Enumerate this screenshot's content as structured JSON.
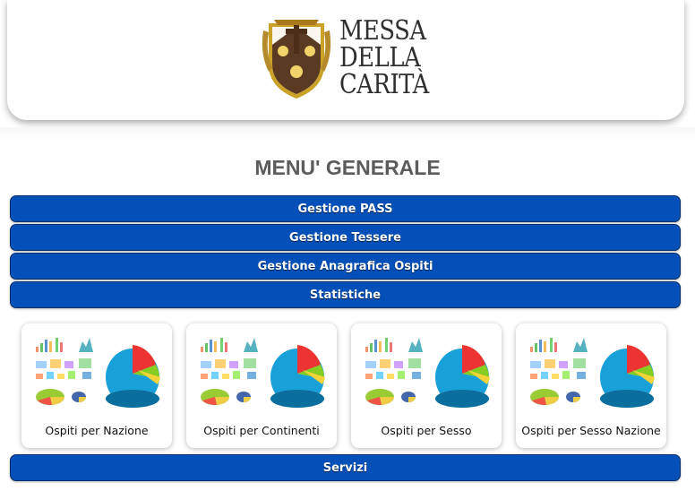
{
  "header": {
    "logo_line1": "MESSA",
    "logo_line2": "DELLA",
    "logo_line3": "CARITÀ"
  },
  "page_title": "MENU' GENERALE",
  "menu": {
    "items": [
      {
        "label": "Gestione PASS"
      },
      {
        "label": "Gestione Tessere"
      },
      {
        "label": "Gestione Anagrafica Ospiti"
      },
      {
        "label": "Statistiche"
      }
    ],
    "services_label": "Servizi"
  },
  "statistics": {
    "cards": [
      {
        "label": "Ospiti per Nazione"
      },
      {
        "label": "Ospiti per Continenti"
      },
      {
        "label": "Ospiti per Sesso"
      },
      {
        "label": "Ospiti per Sesso Nazione"
      }
    ]
  },
  "colors": {
    "button_blue": "#0550b8",
    "title_gray": "#5c5c5c",
    "logo_brown": "#5a3a22",
    "logo_gold": "#c9a227"
  }
}
